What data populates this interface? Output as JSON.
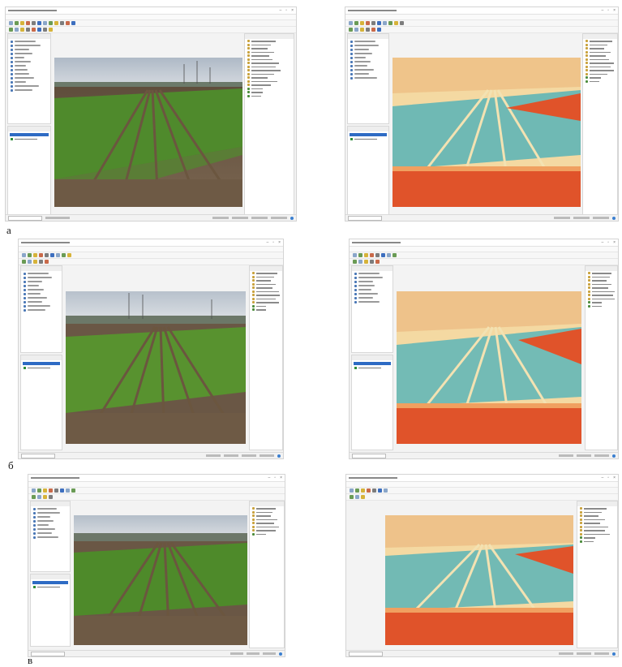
{
  "captions": [
    "а",
    "б",
    "в"
  ],
  "screens": [
    {
      "id": "a-original",
      "kind": "photo",
      "row": 0,
      "col": 0
    },
    {
      "id": "a-index",
      "kind": "index",
      "row": 0,
      "col": 1
    },
    {
      "id": "b-original",
      "kind": "photo",
      "row": 1,
      "col": 0
    },
    {
      "id": "b-index",
      "kind": "index",
      "row": 1,
      "col": 1
    },
    {
      "id": "c-original",
      "kind": "photo",
      "row": 2,
      "col": 0
    },
    {
      "id": "c-index",
      "kind": "index",
      "row": 2,
      "col": 1
    }
  ],
  "colors": {
    "crop_green": "#4f8a2c",
    "soil_brown": "#6e5a45",
    "sky": "#cbd3db",
    "index_cyan": "#6fb9b4",
    "index_red": "#e0532a",
    "index_cream": "#f4d9a2",
    "selection_blue": "#2e6bc4"
  },
  "icons": [
    "window-close-icon",
    "minimize-icon",
    "maximize-icon",
    "toolbar-tool-icon",
    "layer-raster-icon",
    "processing-algorithm-icon"
  ]
}
